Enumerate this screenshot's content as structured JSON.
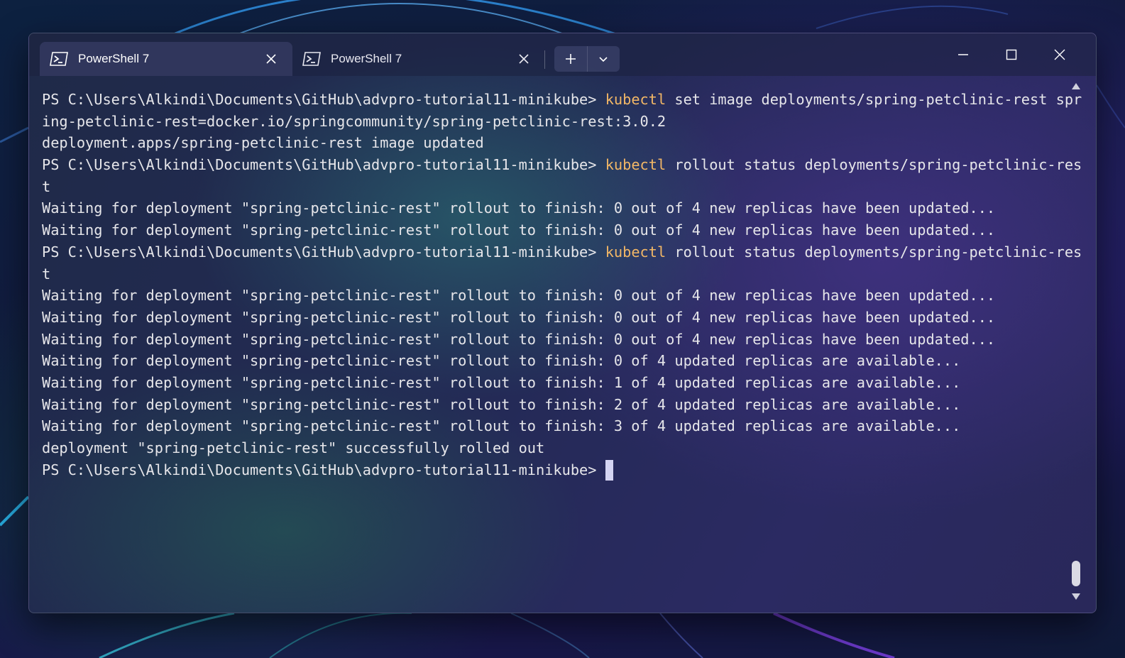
{
  "window": {
    "tabs": [
      {
        "title": "PowerShell 7",
        "icon": "powershell-icon",
        "active": true
      },
      {
        "title": "PowerShell 7",
        "icon": "powershell-icon",
        "active": false
      }
    ],
    "caption_icons": [
      "minimize-icon",
      "maximize-icon",
      "close-icon"
    ],
    "new_tab_icons": [
      "plus-icon",
      "chevron-down-icon"
    ]
  },
  "terminal": {
    "lines": [
      {
        "prompt": "PS C:\\Users\\Alkindi\\Documents\\GitHub\\advpro-tutorial11-minikube> ",
        "cmd": "kubectl",
        "text": " set image deployments/spring-petclinic-rest spr"
      },
      {
        "text": "ing-petclinic-rest=docker.io/springcommunity/spring-petclinic-rest:3.0.2"
      },
      {
        "text": "deployment.apps/spring-petclinic-rest image updated"
      },
      {
        "prompt": "PS C:\\Users\\Alkindi\\Documents\\GitHub\\advpro-tutorial11-minikube> ",
        "cmd": "kubectl",
        "text": " rollout status deployments/spring-petclinic-res"
      },
      {
        "text": "t"
      },
      {
        "text": "Waiting for deployment \"spring-petclinic-rest\" rollout to finish: 0 out of 4 new replicas have been updated..."
      },
      {
        "text": "Waiting for deployment \"spring-petclinic-rest\" rollout to finish: 0 out of 4 new replicas have been updated..."
      },
      {
        "prompt": "PS C:\\Users\\Alkindi\\Documents\\GitHub\\advpro-tutorial11-minikube> ",
        "cmd": "kubectl",
        "text": " rollout status deployments/spring-petclinic-res"
      },
      {
        "text": "t"
      },
      {
        "text": "Waiting for deployment \"spring-petclinic-rest\" rollout to finish: 0 out of 4 new replicas have been updated..."
      },
      {
        "text": "Waiting for deployment \"spring-petclinic-rest\" rollout to finish: 0 out of 4 new replicas have been updated..."
      },
      {
        "text": "Waiting for deployment \"spring-petclinic-rest\" rollout to finish: 0 out of 4 new replicas have been updated..."
      },
      {
        "text": "Waiting for deployment \"spring-petclinic-rest\" rollout to finish: 0 of 4 updated replicas are available..."
      },
      {
        "text": "Waiting for deployment \"spring-petclinic-rest\" rollout to finish: 1 of 4 updated replicas are available..."
      },
      {
        "text": "Waiting for deployment \"spring-petclinic-rest\" rollout to finish: 2 of 4 updated replicas are available..."
      },
      {
        "text": "Waiting for deployment \"spring-petclinic-rest\" rollout to finish: 3 of 4 updated replicas are available..."
      },
      {
        "text": "deployment \"spring-petclinic-rest\" successfully rolled out"
      },
      {
        "prompt": "PS C:\\Users\\Alkindi\\Documents\\GitHub\\advpro-tutorial11-minikube> ",
        "cursor": true
      }
    ]
  },
  "colors": {
    "command_accent": "#f2b766",
    "text": "#e6e6ea",
    "cursor": "#d4d4f2"
  }
}
